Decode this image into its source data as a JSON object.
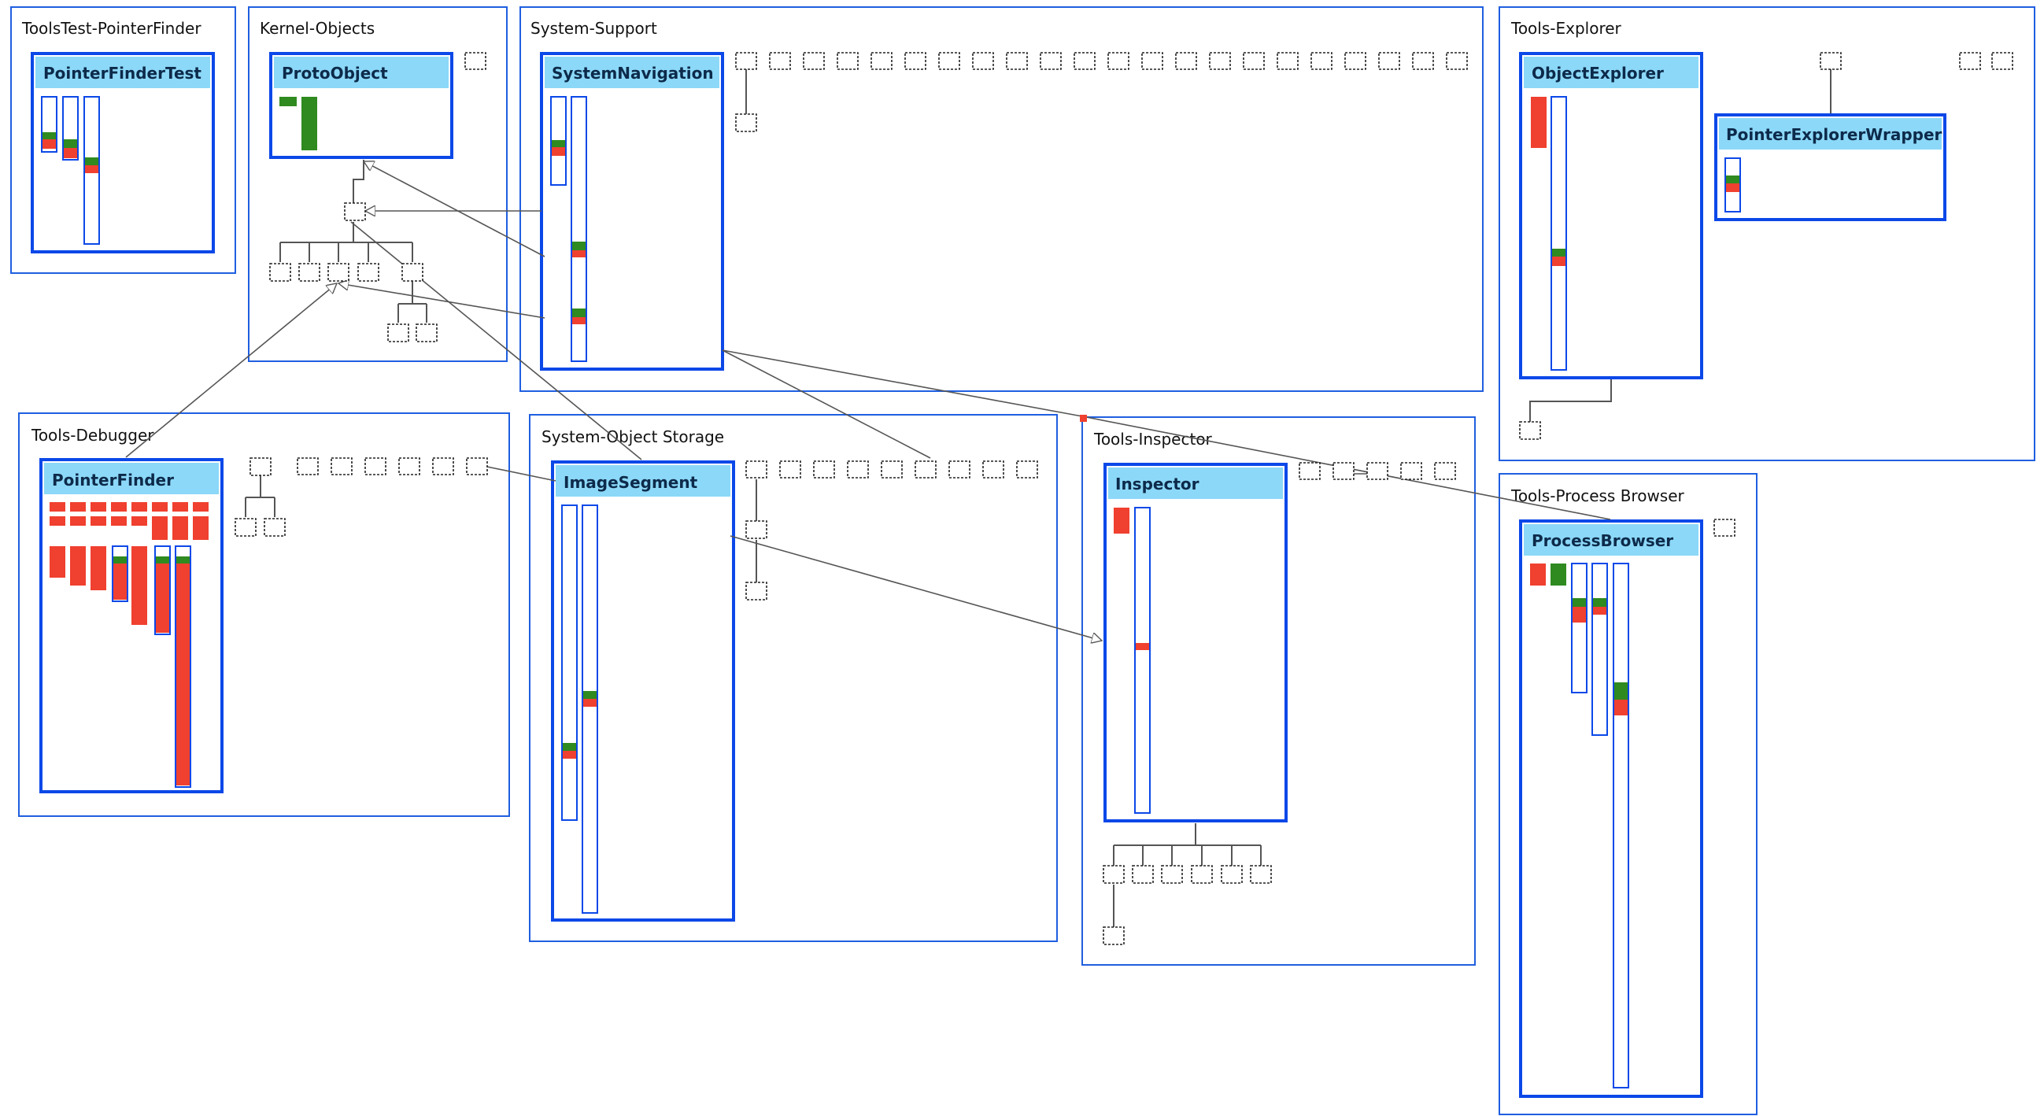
{
  "colors": {
    "package_border": "#1f5fe0",
    "class_border": "#0b48e8",
    "class_header": "#8cd8f8",
    "bar_red": "#f0402f",
    "bar_green": "#2f8a1f",
    "edge": "#555555",
    "stub_border": "#222222"
  },
  "packages": [
    {
      "id": "toolstest-pointerfinder",
      "label": "ToolsTest-PointerFinder"
    },
    {
      "id": "kernel-objects",
      "label": "Kernel-Objects"
    },
    {
      "id": "system-support",
      "label": "System-Support"
    },
    {
      "id": "tools-explorer",
      "label": "Tools-Explorer"
    },
    {
      "id": "tools-debugger",
      "label": "Tools-Debugger"
    },
    {
      "id": "system-object-storage",
      "label": "System-Object Storage"
    },
    {
      "id": "tools-inspector",
      "label": "Tools-Inspector"
    },
    {
      "id": "tools-process-browser",
      "label": "Tools-Process Browser"
    }
  ],
  "classes": [
    {
      "id": "pointerfindertest",
      "name": "PointerFinderTest"
    },
    {
      "id": "protoobject",
      "name": "ProtoObject"
    },
    {
      "id": "systemnavigation",
      "name": "SystemNavigation"
    },
    {
      "id": "objectexplorer",
      "name": "ObjectExplorer"
    },
    {
      "id": "pointerexplorerwrapper",
      "name": "PointerExplorerWrapper"
    },
    {
      "id": "pointerfinder",
      "name": "PointerFinder"
    },
    {
      "id": "imagesegment",
      "name": "ImageSegment"
    },
    {
      "id": "inspector",
      "name": "Inspector"
    },
    {
      "id": "processbrowser",
      "name": "ProcessBrowser"
    }
  ]
}
